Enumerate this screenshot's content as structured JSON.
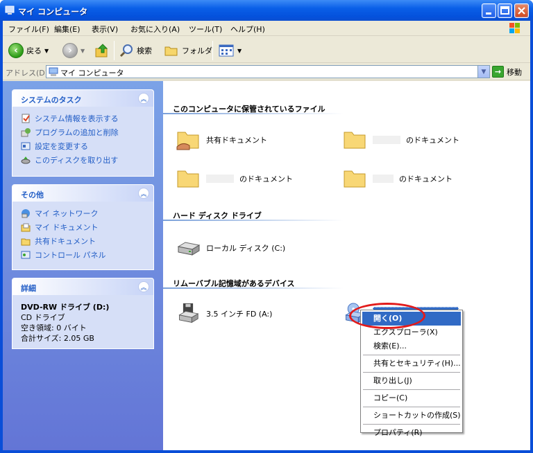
{
  "window": {
    "title": "マイ コンピュータ"
  },
  "menu": [
    "ファイル(F)",
    "編集(E)",
    "表示(V)",
    "お気に入り(A)",
    "ツール(T)",
    "ヘルプ(H)"
  ],
  "toolbar": {
    "back": "戻る",
    "search": "検索",
    "folders": "フォルダ"
  },
  "address": {
    "label": "アドレス(D)",
    "value": "マイ コンピュータ",
    "go": "移動"
  },
  "panels": {
    "system": {
      "title": "システムのタスク",
      "items": [
        "システム情報を表示する",
        "プログラムの追加と削除",
        "設定を変更する",
        "このディスクを取り出す"
      ]
    },
    "other": {
      "title": "その他",
      "items": [
        "マイ ネットワーク",
        "マイ ドキュメント",
        "共有ドキュメント",
        "コントロール パネル"
      ]
    },
    "details": {
      "title": "詳細",
      "name": "DVD-RW ドライブ (D:)",
      "type": "CD ドライブ",
      "free": "空き領域: 0 バイト",
      "total": "合計サイズ: 2.05 GB"
    }
  },
  "groups": {
    "files": {
      "title": "このコンピュータに保管されているファイル",
      "items": [
        "共有ドキュメント",
        "のドキュメント",
        "のドキュメント",
        "のドキュメント"
      ]
    },
    "hdd": {
      "title": "ハード ディスク ドライブ",
      "items": [
        "ローカル ディスク (C:)"
      ]
    },
    "removable": {
      "title": "リムーバブル記憶域があるデバイス",
      "items": [
        "3.5 インチ FD (A:)",
        "DVD-RW ドライブ (D:)"
      ]
    }
  },
  "context_menu": {
    "items": [
      "開く(O)",
      "エクスプローラ(X)",
      "検索(E)...",
      "共有とセキュリティ(H)...",
      "取り出し(J)",
      "コピー(C)",
      "ショートカットの作成(S)",
      "プロパティ(R)"
    ]
  },
  "colors": {
    "title_blue": "#0a5fe8",
    "task_link": "#215dc6",
    "selection": "#316ac5",
    "highlight_circle": "#e21b1b"
  }
}
